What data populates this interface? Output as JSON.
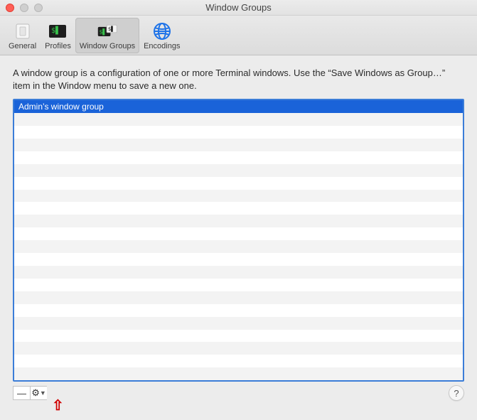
{
  "window": {
    "title": "Window Groups"
  },
  "toolbar": {
    "tabs": [
      {
        "id": "general",
        "label": "General",
        "selected": false
      },
      {
        "id": "profiles",
        "label": "Profiles",
        "selected": false
      },
      {
        "id": "windowgroups",
        "label": "Window Groups",
        "selected": true
      },
      {
        "id": "encodings",
        "label": "Encodings",
        "selected": false
      }
    ]
  },
  "description": "A window group is a configuration of one or more Terminal windows. Use the “Save Windows as Group…” item in the Window menu to save a new one.",
  "list": {
    "items": [
      {
        "label": "Admin’s window group",
        "selected": true
      }
    ],
    "visible_rows": 22
  },
  "footer": {
    "remove_label": "—",
    "actions_label": "⚙",
    "help_label": "?"
  }
}
